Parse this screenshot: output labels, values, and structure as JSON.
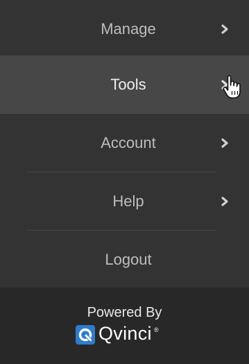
{
  "menu": {
    "items": [
      {
        "label": "Manage",
        "has_submenu": true,
        "active": false
      },
      {
        "label": "Tools",
        "has_submenu": true,
        "active": true
      },
      {
        "label": "Account",
        "has_submenu": true,
        "active": false
      },
      {
        "label": "Help",
        "has_submenu": true,
        "active": false
      },
      {
        "label": "Logout",
        "has_submenu": false,
        "active": false
      }
    ],
    "submenu_icon": "chevron-right-icon",
    "cursor_icon": "hand-pointer-icon"
  },
  "footer": {
    "powered_by": "Powered By",
    "brand_name": "Qvinci",
    "brand_mark": "®",
    "brand_logo_icon": "qvinci-logo-icon"
  },
  "colors": {
    "background": "#333333",
    "active_item": "#474747",
    "footer_background": "#282828",
    "brand_blue": "#2f7ccf",
    "text": "#bdbdbd",
    "active_text": "#efefef"
  }
}
